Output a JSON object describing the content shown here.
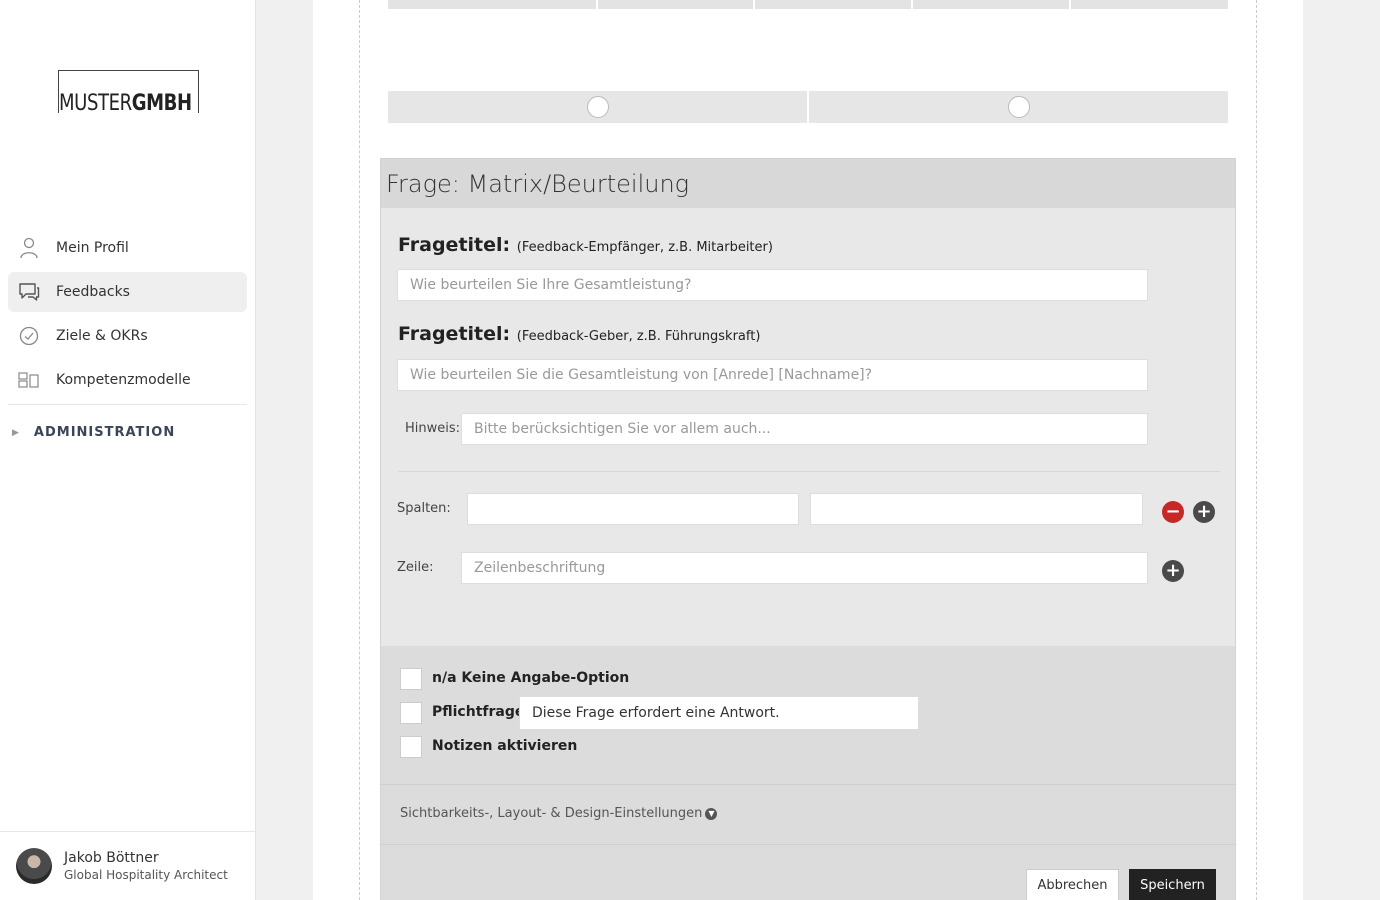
{
  "brand": {
    "logo_text_light": "MUSTER",
    "logo_text_bold": "GMBH"
  },
  "sidebar": {
    "items": [
      {
        "label": "Mein Profil",
        "icon": "user-icon",
        "active": false
      },
      {
        "label": "Feedbacks",
        "icon": "chat-icon",
        "active": true
      },
      {
        "label": "Ziele & OKRs",
        "icon": "check-circle-icon",
        "active": false
      },
      {
        "label": "Kompetenzmodelle",
        "icon": "model-icon",
        "active": false
      }
    ],
    "admin_label": "ADMINISTRATION"
  },
  "user": {
    "name": "Jakob Böttner",
    "role": "Global Hospitality Architect"
  },
  "question": {
    "header": "Frage: Matrix/Beurteilung",
    "title_label": "Fragetitel:",
    "title1_note": "(Feedback-Empfänger, z.B. Mitarbeiter)",
    "title1_placeholder": "Wie beurteilen Sie Ihre Gesamtleistung?",
    "title2_note": "(Feedback-Geber, z.B. Führungskraft)",
    "title2_placeholder": "Wie beurteilen Sie die Gesamtleistung von [Anrede] [Nachname]?",
    "hint_label": "Hinweis:",
    "hint_placeholder": "Bitte berücksichtigen Sie vor allem auch...",
    "columns_label": "Spalten:",
    "columns": [
      "",
      ""
    ],
    "row_label": "Zeile:",
    "row_placeholder": "Zeilenbeschriftung"
  },
  "options": {
    "na_label": "n/a Keine Angabe-Option",
    "required_label": "Pflichtfrage",
    "required_message": "Diese Frage erfordert eine Antwort.",
    "notes_label": "Notizen aktivieren",
    "visibility_link": "Sichtbarkeits-, Layout- & Design-Einstellungen"
  },
  "actions": {
    "cancel": "Abbrechen",
    "save": "Speichern"
  },
  "colors": {
    "remove": "#c62828",
    "add": "#4a4a4a",
    "save_bg": "#222222"
  }
}
